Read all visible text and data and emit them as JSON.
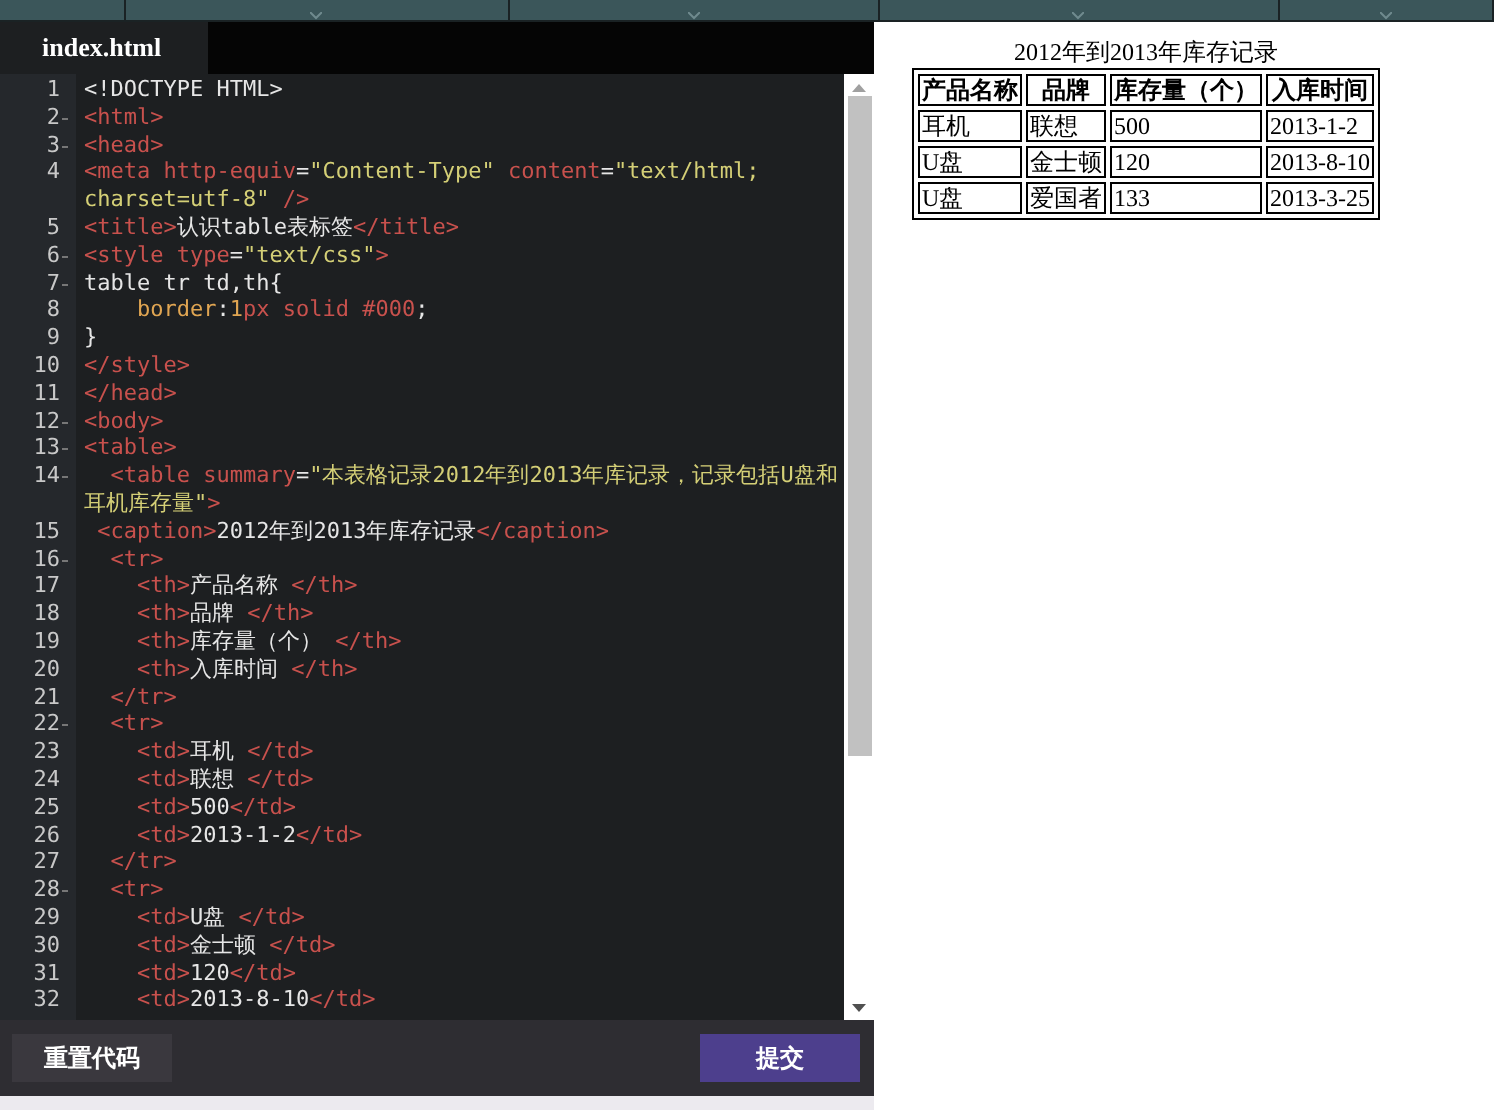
{
  "editor": {
    "tab": {
      "label": "index.html",
      "selected": true
    },
    "lines": [
      {
        "number": "1",
        "foldable": false,
        "tokens": [
          {
            "kind": "plain",
            "text": "<!DOCTYPE HTML>"
          }
        ]
      },
      {
        "number": "2",
        "foldable": true,
        "tokens": [
          {
            "kind": "tag",
            "text": "<html>"
          }
        ]
      },
      {
        "number": "3",
        "foldable": true,
        "tokens": [
          {
            "kind": "tag",
            "text": "<head>"
          }
        ]
      },
      {
        "number": "4",
        "foldable": false,
        "tokens": [
          {
            "kind": "tag",
            "text": "<meta "
          },
          {
            "kind": "attr",
            "text": "http-equiv"
          },
          {
            "kind": "plain",
            "text": "="
          },
          {
            "kind": "string",
            "text": "\"Content-Type\""
          },
          {
            "kind": "attr",
            "text": " content"
          },
          {
            "kind": "plain",
            "text": "="
          },
          {
            "kind": "string",
            "text": "\"text/html; charset=utf-8\""
          },
          {
            "kind": "tag",
            "text": " />"
          }
        ]
      },
      {
        "number": "5",
        "foldable": false,
        "tokens": [
          {
            "kind": "tag",
            "text": "<title>"
          },
          {
            "kind": "plain",
            "text": "认识table表标签"
          },
          {
            "kind": "tag",
            "text": "</title>"
          }
        ]
      },
      {
        "number": "6",
        "foldable": true,
        "tokens": [
          {
            "kind": "tag",
            "text": "<style "
          },
          {
            "kind": "attr",
            "text": "type"
          },
          {
            "kind": "plain",
            "text": "="
          },
          {
            "kind": "string",
            "text": "\"text/css\""
          },
          {
            "kind": "tag",
            "text": ">"
          }
        ]
      },
      {
        "number": "7",
        "foldable": true,
        "tokens": [
          {
            "kind": "plain",
            "text": "table tr td,th{"
          }
        ]
      },
      {
        "number": "8",
        "foldable": false,
        "tokens": [
          {
            "kind": "prop",
            "text": "    border"
          },
          {
            "kind": "plain",
            "text": ":"
          },
          {
            "kind": "prop",
            "text": "1"
          },
          {
            "kind": "attr",
            "text": "px solid #000"
          },
          {
            "kind": "plain",
            "text": ";"
          }
        ]
      },
      {
        "number": "9",
        "foldable": false,
        "tokens": [
          {
            "kind": "plain",
            "text": "}"
          }
        ]
      },
      {
        "number": "10",
        "foldable": false,
        "tokens": [
          {
            "kind": "tag",
            "text": "</style>"
          }
        ]
      },
      {
        "number": "11",
        "foldable": false,
        "tokens": [
          {
            "kind": "tag",
            "text": "</head>"
          }
        ]
      },
      {
        "number": "12",
        "foldable": true,
        "tokens": [
          {
            "kind": "tag",
            "text": "<body>"
          }
        ]
      },
      {
        "number": "13",
        "foldable": true,
        "tokens": [
          {
            "kind": "tag",
            "text": "<table>"
          }
        ]
      },
      {
        "number": "14",
        "foldable": true,
        "tokens": [
          {
            "kind": "tag",
            "text": "  <table "
          },
          {
            "kind": "attr",
            "text": "summary"
          },
          {
            "kind": "plain",
            "text": "="
          },
          {
            "kind": "string",
            "text": "\"本表格记录2012年到2013年库记录，记录包括U盘和耳机库存量\""
          },
          {
            "kind": "tag",
            "text": ">"
          }
        ]
      },
      {
        "number": "15",
        "foldable": false,
        "tokens": [
          {
            "kind": "tag",
            "text": " <caption>"
          },
          {
            "kind": "plain",
            "text": "2012年到2013年库存记录"
          },
          {
            "kind": "tag",
            "text": "</caption>"
          }
        ]
      },
      {
        "number": "16",
        "foldable": true,
        "tokens": [
          {
            "kind": "tag",
            "text": "  <tr>"
          }
        ]
      },
      {
        "number": "17",
        "foldable": false,
        "tokens": [
          {
            "kind": "tag",
            "text": "    <th>"
          },
          {
            "kind": "plain",
            "text": "产品名称 "
          },
          {
            "kind": "tag",
            "text": "</th>"
          }
        ]
      },
      {
        "number": "18",
        "foldable": false,
        "tokens": [
          {
            "kind": "tag",
            "text": "    <th>"
          },
          {
            "kind": "plain",
            "text": "品牌 "
          },
          {
            "kind": "tag",
            "text": "</th>"
          }
        ]
      },
      {
        "number": "19",
        "foldable": false,
        "tokens": [
          {
            "kind": "tag",
            "text": "    <th>"
          },
          {
            "kind": "plain",
            "text": "库存量（个） "
          },
          {
            "kind": "tag",
            "text": "</th>"
          }
        ]
      },
      {
        "number": "20",
        "foldable": false,
        "tokens": [
          {
            "kind": "tag",
            "text": "    <th>"
          },
          {
            "kind": "plain",
            "text": "入库时间 "
          },
          {
            "kind": "tag",
            "text": "</th>"
          }
        ]
      },
      {
        "number": "21",
        "foldable": false,
        "tokens": [
          {
            "kind": "tag",
            "text": "  </tr>"
          }
        ]
      },
      {
        "number": "22",
        "foldable": true,
        "tokens": [
          {
            "kind": "tag",
            "text": "  <tr>"
          }
        ]
      },
      {
        "number": "23",
        "foldable": false,
        "tokens": [
          {
            "kind": "tag",
            "text": "    <td>"
          },
          {
            "kind": "plain",
            "text": "耳机 "
          },
          {
            "kind": "tag",
            "text": "</td>"
          }
        ]
      },
      {
        "number": "24",
        "foldable": false,
        "tokens": [
          {
            "kind": "tag",
            "text": "    <td>"
          },
          {
            "kind": "plain",
            "text": "联想 "
          },
          {
            "kind": "tag",
            "text": "</td>"
          }
        ]
      },
      {
        "number": "25",
        "foldable": false,
        "tokens": [
          {
            "kind": "tag",
            "text": "    <td>"
          },
          {
            "kind": "plain",
            "text": "500"
          },
          {
            "kind": "tag",
            "text": "</td>"
          }
        ]
      },
      {
        "number": "26",
        "foldable": false,
        "tokens": [
          {
            "kind": "tag",
            "text": "    <td>"
          },
          {
            "kind": "plain",
            "text": "2013-1-2"
          },
          {
            "kind": "tag",
            "text": "</td>"
          }
        ]
      },
      {
        "number": "27",
        "foldable": false,
        "tokens": [
          {
            "kind": "tag",
            "text": "  </tr>"
          }
        ]
      },
      {
        "number": "28",
        "foldable": true,
        "tokens": [
          {
            "kind": "tag",
            "text": "  <tr>"
          }
        ]
      },
      {
        "number": "29",
        "foldable": false,
        "tokens": [
          {
            "kind": "tag",
            "text": "    <td>"
          },
          {
            "kind": "plain",
            "text": "U盘 "
          },
          {
            "kind": "tag",
            "text": "</td>"
          }
        ]
      },
      {
        "number": "30",
        "foldable": false,
        "tokens": [
          {
            "kind": "tag",
            "text": "    <td>"
          },
          {
            "kind": "plain",
            "text": "金士顿 "
          },
          {
            "kind": "tag",
            "text": "</td>"
          }
        ]
      },
      {
        "number": "31",
        "foldable": false,
        "tokens": [
          {
            "kind": "tag",
            "text": "    <td>"
          },
          {
            "kind": "plain",
            "text": "120"
          },
          {
            "kind": "tag",
            "text": "</td>"
          }
        ]
      },
      {
        "number": "32",
        "foldable": false,
        "tokens": [
          {
            "kind": "tag",
            "text": "    <td>"
          },
          {
            "kind": "plain",
            "text": "2013-8-10"
          },
          {
            "kind": "tag",
            "text": "</td>"
          }
        ]
      }
    ],
    "buttons": [
      {
        "kind": "secondary",
        "label": "重置代码"
      },
      {
        "kind": "primary",
        "label": "提交"
      }
    ]
  },
  "preview": {
    "caption": "2012年到2013年库存记录",
    "columns": [
      "产品名称",
      "品牌",
      "库存量（个）",
      "入库时间"
    ],
    "rows": [
      [
        "耳机",
        "联想",
        "500",
        "2013-1-2"
      ],
      [
        "U盘",
        "金士顿",
        "120",
        "2013-8-10"
      ],
      [
        "U盘",
        "爱国者",
        "133",
        "2013-3-25"
      ]
    ]
  }
}
